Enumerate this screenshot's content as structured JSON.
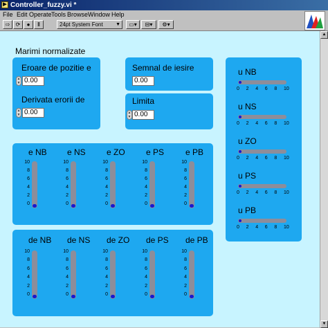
{
  "window": {
    "title": "Controller_fuzzy.vi *"
  },
  "menu": [
    "File",
    "Edit",
    "Operate",
    "Tools",
    "Browse",
    "Window",
    "Help"
  ],
  "toolbar": {
    "font_select": "24pt System Font"
  },
  "panel": {
    "heading": "Marimi normalizate",
    "inputs": {
      "eroare": {
        "label": "Eroare de pozitie e",
        "value": "0.00"
      },
      "derivata": {
        "label": "Derivata erorii de",
        "value": "0.00"
      }
    },
    "semnal": {
      "label": "Semnal de iesire",
      "value": "0.00"
    },
    "limita": {
      "label": "Limita",
      "value": "0.00"
    },
    "e_tanks": {
      "labels": [
        "e NB",
        "e NS",
        "e ZO",
        "e PS",
        "e PB"
      ],
      "scale": [
        "10",
        "8",
        "6",
        "4",
        "2",
        "0"
      ],
      "values": [
        0,
        0,
        0,
        0,
        0
      ]
    },
    "de_tanks": {
      "labels": [
        "de NB",
        "de NS",
        "de ZO",
        "de PS",
        "de PB"
      ],
      "scale": [
        "10",
        "8",
        "6",
        "4",
        "2",
        "0"
      ],
      "values": [
        0,
        0,
        0,
        0,
        0
      ]
    },
    "u_bars": {
      "labels": [
        "u NB",
        "u NS",
        "u ZO",
        "u PS",
        "u PB"
      ],
      "scale": [
        "0",
        "2",
        "4",
        "6",
        "8",
        "10"
      ],
      "values": [
        0,
        0,
        0,
        0,
        0
      ]
    }
  },
  "colors": {
    "panel_bg": "#c8f4ff",
    "cluster": "#1ea8f0",
    "gauge": "#8d8d9a",
    "fill": "#1818d0",
    "titlebar": "#0a246a"
  }
}
